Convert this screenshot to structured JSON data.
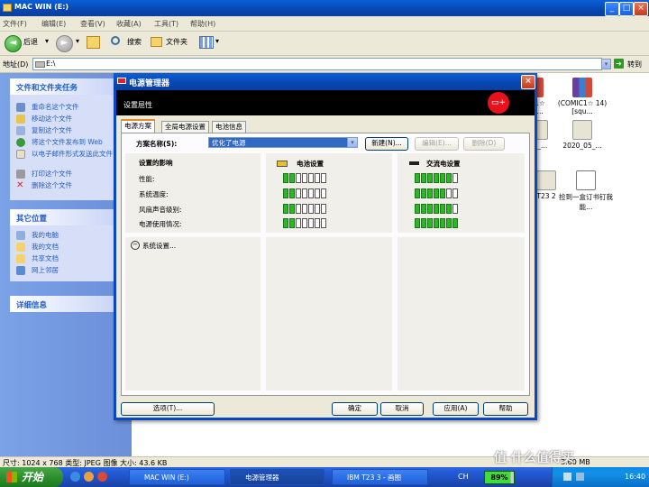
{
  "explorer": {
    "title": "MAC WIN (E:)",
    "menu": [
      "文件(F)",
      "编辑(E)",
      "查看(V)",
      "收藏(A)",
      "工具(T)",
      "帮助(H)"
    ],
    "toolbar": {
      "back": "后退",
      "search": "搜索",
      "folders": "文件夹"
    },
    "address_label": "地址(D)",
    "address_value": "E:\\",
    "go_label": "转到",
    "status": "尺寸: 1024 x 768 类型: JPEG 图像 大小: 43.6 KB",
    "status_right": "3.60 MB"
  },
  "task_pane": {
    "file_tasks": {
      "title": "文件和文件夹任务",
      "items": [
        "重命名这个文件",
        "移动这个文件",
        "复制这个文件",
        "将这个文件发布到 Web",
        "以电子邮件形式发送此文件",
        "打印这个文件",
        "删除这个文件"
      ]
    },
    "other_places": {
      "title": "其它位置",
      "items": [
        "我的电脑",
        "我的文档",
        "共享文档",
        "网上邻居"
      ]
    },
    "details": {
      "title": "详细信息"
    }
  },
  "files": [
    {
      "label": "MIC1☆ Squ..."
    },
    {
      "label": "(COMIC1☆ 14) [squ..."
    },
    {
      "label": "05_..."
    },
    {
      "label": "2020_05_..."
    },
    {
      "label": "T23 2"
    },
    {
      "label": "捡到一盒订书钉我能..."
    }
  ],
  "dialog": {
    "title": "电源管理器",
    "header": "设置屈性",
    "tabs": [
      "电源方案",
      "全局电源设置",
      "电池信息"
    ],
    "scheme_label": "方案名称(S):",
    "scheme_value": "优化了电源",
    "buttons": {
      "new": "新建(N)...",
      "edit": "编辑(E)...",
      "delete": "删除(D)"
    },
    "impact_header": "设置的影响",
    "battery_header": "电池设置",
    "ac_header": "交流电设置",
    "rows": [
      {
        "label": "性能:",
        "battery": 2,
        "ac": 6
      },
      {
        "label": "系统温度:",
        "battery": 2,
        "ac": 5
      },
      {
        "label": "风扇声音级别:",
        "battery": 2,
        "ac": 6
      },
      {
        "label": "电源使用情况:",
        "battery": 2,
        "ac": 7
      }
    ],
    "segments": 7,
    "system_settings": "系统设置...",
    "footer": {
      "options": "选项(T)...",
      "ok": "确定",
      "cancel": "取消",
      "apply": "应用(A)",
      "help": "帮助"
    }
  },
  "taskbar": {
    "start": "开始",
    "items": [
      "MAC WIN (E:)",
      "电源管理器",
      "IBM T23 3 - 画图"
    ],
    "lang": "CH",
    "battery": "89%",
    "clock": "16:40"
  },
  "watermark": "值 什么值得买",
  "colors": {
    "xp_blue": "#0a5fd8",
    "pane_blue": "#7ba2e7",
    "bar_green": "#2fb52a",
    "start_green": "#2f8f2f"
  }
}
